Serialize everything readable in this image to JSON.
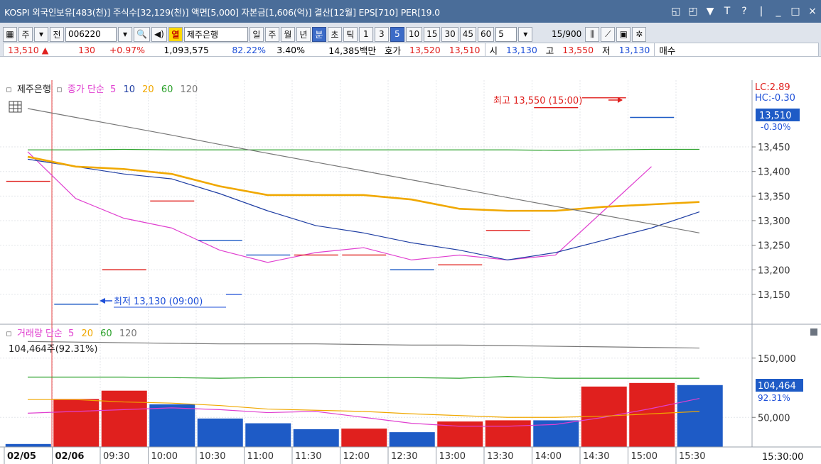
{
  "title": "KOSPI 외국인보유[483(천)] 주식수[32,129(천)] 액면[5,000] 자본금[1,606(억)] 결산[12월] EPS[710] PER[19.0",
  "window_buttons": [
    "◱",
    "◰",
    "▼",
    "T",
    "?",
    "|",
    "_",
    "□",
    "×"
  ],
  "toolbar": {
    "grid_icon": "▦",
    "ju": "주",
    "jeon": "전",
    "code": "006220",
    "search_icon": "🔍",
    "sound_icon": "◀)",
    "yeol": "열",
    "stock_name": "제주은행",
    "periods": [
      "일",
      "주",
      "월",
      "년"
    ],
    "selected_period": "분",
    "periods2": [
      "초",
      "틱"
    ],
    "intervals": [
      "1",
      "3",
      "5",
      "10",
      "15",
      "30",
      "45",
      "60"
    ],
    "selected_interval": "5",
    "count": "5",
    "count_value": "15",
    "count_total": "/900"
  },
  "quote": {
    "price": "13,510 ▲",
    "change": "130",
    "change_pct": "+0.97%",
    "volume": "1,093,575",
    "vol_ratio": "82.22%",
    "turnover": "3.40%",
    "amount": "14,385백만",
    "hoga_label": "호가",
    "ask": "13,520",
    "bid": "13,510",
    "open_label": "시",
    "open": "13,130",
    "high_label": "고",
    "high": "13,550",
    "low_label": "저",
    "low": "13,130",
    "buy_label": "매수"
  },
  "legend_price": {
    "name": "제주은행",
    "ma_label": "종가 단순",
    "p1": "5",
    "p2": "10",
    "p3": "20",
    "p4": "60",
    "p5": "120"
  },
  "legend_volume": {
    "ma_label": "거래량 단순",
    "p1": "5",
    "p2": "20",
    "p3": "60",
    "p4": "120",
    "current": "104,464주(92.31%)"
  },
  "annotations": {
    "high": "최고 13,550 (15:00)",
    "low": "최저 13,130 (09:00)",
    "lc": "LC:2.89",
    "hc": "HC:-0.30"
  },
  "price_axis_box": {
    "value": "13,510",
    "pct": "-0.30%"
  },
  "volume_axis_box": {
    "value": "104,464",
    "pct": "92.31%"
  },
  "bottom_right_time": "15:30:00",
  "colors": {
    "up": "#e0201e",
    "down": "#1e5bc6",
    "ma5": "#e040d0",
    "ma10": "#1f3ea3",
    "ma20": "#f0a800",
    "ma60": "#2aa02a",
    "ma120": "#777777"
  },
  "chart_data": [
    {
      "type": "candlestick",
      "x": [
        "02/05",
        "02/06",
        "09:30",
        "10:00",
        "10:30",
        "11:00",
        "11:30",
        "12:00",
        "12:30",
        "13:00",
        "13:30",
        "14:00",
        "14:30",
        "15:00",
        "15:30"
      ],
      "close": [
        13380,
        13130,
        13200,
        13340,
        13260,
        13230,
        13230,
        13230,
        13200,
        13210,
        13280,
        13530,
        13550,
        13510
      ],
      "yticks": [
        13450,
        13400,
        13350,
        13300,
        13250,
        13200,
        13150
      ],
      "ylim": [
        13095,
        13580
      ],
      "series": [
        {
          "name": "5",
          "values": [
            13440,
            13345,
            13305,
            13285,
            13240,
            13215,
            13235,
            13245,
            13220,
            13230,
            13220,
            13230,
            13320,
            13410
          ]
        },
        {
          "name": "10",
          "values": [
            13425,
            13410,
            13395,
            13385,
            13355,
            13320,
            13290,
            13275,
            13255,
            13240,
            13220,
            13235,
            13260,
            13285,
            13318
          ]
        },
        {
          "name": "20",
          "values": [
            13430,
            13410,
            13405,
            13395,
            13370,
            13352,
            13352,
            13352,
            13343,
            13324,
            13320,
            13320,
            13328,
            13333,
            13338
          ]
        },
        {
          "name": "60",
          "values": [
            13444,
            13444,
            13445,
            13444,
            13444,
            13444,
            13444,
            13444,
            13444,
            13444,
            13444,
            13443,
            13444,
            13445,
            13445
          ]
        },
        {
          "name": "120",
          "values": [
            13528,
            13510,
            13492,
            13474,
            13455,
            13437,
            13419,
            13401,
            13383,
            13365,
            13347,
            13329,
            13311,
            13293,
            13275
          ]
        }
      ]
    },
    {
      "type": "bar",
      "categories": [
        "02/05",
        "02/06",
        "09:30",
        "10:00",
        "10:30",
        "11:00",
        "11:30",
        "12:00",
        "12:30",
        "13:00",
        "13:30",
        "14:00",
        "14:30",
        "15:00",
        "15:30"
      ],
      "values": [
        5000,
        81000,
        95000,
        72000,
        48000,
        40000,
        30000,
        31000,
        25000,
        43000,
        45000,
        45000,
        102000,
        108000,
        104464
      ],
      "direction": [
        "down",
        "up",
        "up",
        "down",
        "down",
        "down",
        "down",
        "up",
        "down",
        "up",
        "up",
        "down",
        "up",
        "up",
        "down"
      ],
      "yticks": [
        150000,
        50000
      ],
      "ylim": [
        0,
        200000
      ],
      "series": [
        {
          "name": "5",
          "values": [
            57000,
            60000,
            63000,
            66000,
            63000,
            58000,
            60000,
            50000,
            40000,
            35000,
            35000,
            38000,
            50000,
            65000,
            82000
          ]
        },
        {
          "name": "20",
          "values": [
            80000,
            80000,
            76000,
            74000,
            70000,
            64000,
            62000,
            60000,
            56000,
            53000,
            50000,
            50000,
            52000,
            56000,
            60000
          ]
        },
        {
          "name": "60",
          "values": [
            118000,
            118000,
            118000,
            117000,
            116000,
            117000,
            117000,
            117000,
            117000,
            116000,
            119000,
            116000,
            116000,
            116000,
            116000
          ]
        },
        {
          "name": "120",
          "values": [
            178000,
            177000,
            176000,
            175000,
            174000,
            174000,
            174000,
            173000,
            172000,
            172000,
            171000,
            170000,
            169000,
            168000,
            167000
          ]
        }
      ]
    }
  ]
}
